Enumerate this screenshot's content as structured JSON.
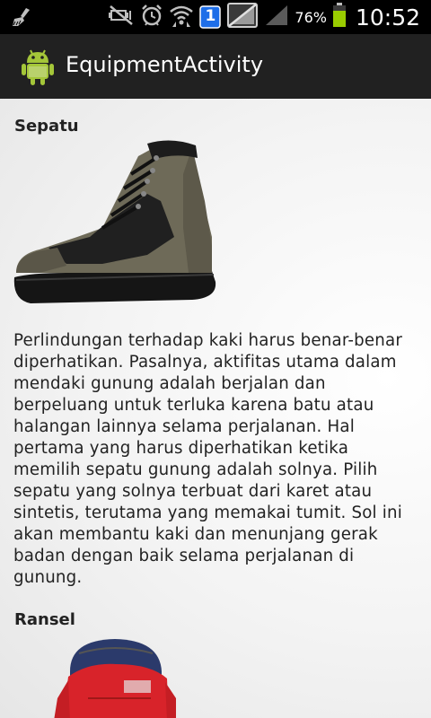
{
  "status_bar": {
    "battery_percent": "76%",
    "time": "10:52",
    "notification_badge": "1",
    "icons": [
      "broom-icon",
      "mute-icon",
      "alarm-icon",
      "wifi-icon",
      "notification-badge-icon",
      "no-sim-icon",
      "signal-icon",
      "battery-icon"
    ]
  },
  "action_bar": {
    "title": "EquipmentActivity",
    "icon": "android-icon"
  },
  "items": [
    {
      "title": "Sepatu",
      "image": "hiking-boot",
      "description": "Perlindungan terhadap kaki harus benar-benar diperhatikan. Pasalnya, aktifitas utama dalam mendaki gunung adalah berjalan dan berpeluang untuk terluka karena batu atau halangan lainnya selama perjalanan. Hal pertama yang harus diperhatikan ketika memilih sepatu gunung adalah solnya. Pilih sepatu yang solnya terbuat dari karet atau sintetis, terutama yang memakai tumit. Sol ini akan membantu kaki dan menunjang gerak badan dengan baik selama perjalanan di gunung."
    },
    {
      "title": "Ransel",
      "image": "backpack"
    }
  ],
  "colors": {
    "status_bar": "#000000",
    "action_bar": "#212121",
    "background": "#f1f1f1",
    "text": "#222222",
    "battery": "#99cc00",
    "notification_badge": "#1e6ee8"
  }
}
